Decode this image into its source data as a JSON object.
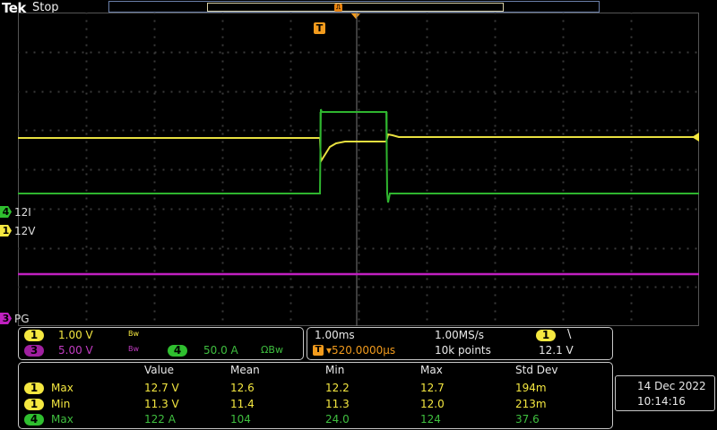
{
  "header": {
    "brand": "Tek",
    "run_state": "Stop"
  },
  "trigger_marker": "T",
  "channels": {
    "ch4": {
      "num": "4",
      "label": "12I",
      "color": "#2fbf2f"
    },
    "ch1": {
      "num": "1",
      "label": "12V",
      "color": "#f5e840"
    },
    "ch3": {
      "num": "3",
      "label": "PG",
      "color": "#c020c0"
    }
  },
  "vertical": {
    "ch1": {
      "num": "1",
      "scale": "1.00 V",
      "bw": "Bw"
    },
    "ch3": {
      "num": "3",
      "scale": "5.00 V",
      "bw": "Bw"
    },
    "ch4": {
      "num": "4",
      "scale": "50.0 A",
      "bw": "ΩBw"
    }
  },
  "horizontal": {
    "timebase": "1.00ms",
    "sample_rate": "1.00MS/s",
    "delay": "▾520.0000µs",
    "record_length": "10k points",
    "trigger_source": "1",
    "trigger_slope": "\\",
    "trigger_level": "12.1 V"
  },
  "measurements": {
    "headers": [
      "Value",
      "Mean",
      "Min",
      "Max",
      "Std Dev"
    ],
    "rows": [
      {
        "ch": "1",
        "name": "Max",
        "value": "12.7 V",
        "mean": "12.6",
        "min": "12.2",
        "max": "12.7",
        "std": "194m",
        "color": "#f5e840"
      },
      {
        "ch": "1",
        "name": "Min",
        "value": "11.3 V",
        "mean": "11.4",
        "min": "11.3",
        "max": "12.0",
        "std": "213m",
        "color": "#f5e840"
      },
      {
        "ch": "4",
        "name": "Max",
        "value": "122 A",
        "mean": "104",
        "min": "24.0",
        "max": "124",
        "std": "37.6",
        "color": "#3fbf3f"
      }
    ]
  },
  "datetime": {
    "date": "14 Dec  2022",
    "time": "10:14:16"
  }
}
